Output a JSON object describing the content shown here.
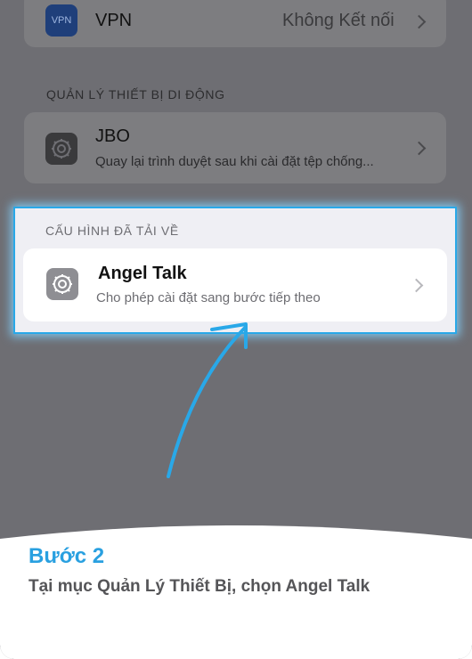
{
  "vpn": {
    "icon_text": "VPN",
    "label": "VPN",
    "value": "Không Kết nối"
  },
  "mdm_section": {
    "header": "QUẢN LÝ THIẾT BỊ DI ĐỘNG",
    "profile": {
      "title": "JBO",
      "subtitle": "Quay lại trình duyệt sau khi cài đặt tệp chống..."
    }
  },
  "downloaded_section": {
    "header": "CẤU HÌNH ĐÃ TẢI VỀ",
    "profile": {
      "title": "Angel Talk",
      "subtitle": "Cho phép cài đặt sang bước tiếp theo"
    }
  },
  "instruction": {
    "step_title": "Bước 2",
    "step_description": "Tại mục Quản Lý Thiết Bị, chọn Angel Talk"
  },
  "colors": {
    "accent": "#29a8e8",
    "step_title": "#29a0e0",
    "overlay": "#6e6e73"
  }
}
